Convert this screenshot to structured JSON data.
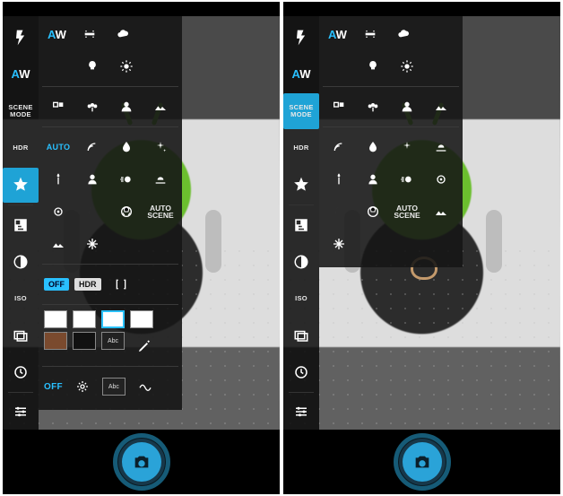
{
  "accent": "#29c0ff",
  "sidebar": {
    "items": [
      {
        "name": "flash-icon",
        "label": ""
      },
      {
        "name": "awb-icon",
        "label": "AW"
      },
      {
        "name": "scene-mode",
        "label": "SCENE\nMODE"
      },
      {
        "name": "hdr",
        "label": "HDR"
      },
      {
        "name": "favorite-star",
        "label": ""
      },
      {
        "name": "exposure-comp",
        "label": ""
      },
      {
        "name": "contrast",
        "label": ""
      },
      {
        "name": "iso",
        "label": "ISO"
      },
      {
        "name": "bracketing",
        "label": ""
      },
      {
        "name": "timer",
        "label": ""
      },
      {
        "name": "sliders",
        "label": ""
      }
    ]
  },
  "panel": {
    "wb": {
      "auto_label": "AW",
      "options": [
        "auto",
        "flash",
        "cloudy",
        "incandescent",
        "daylight"
      ]
    },
    "focus": {
      "options": [
        "burst",
        "macro",
        "portrait",
        "landscape"
      ]
    },
    "scene": {
      "auto_label": "AUTO",
      "options": [
        "curves",
        "droplet",
        "sparkle",
        "candle",
        "face",
        "motion",
        "night",
        "moon",
        "sports",
        "auto-scene",
        "sunset",
        "snow"
      ],
      "auto_scene_label": "AUTO\nSCENE"
    },
    "hdr_row": {
      "off_label": "OFF",
      "hdr_label": "HDR"
    },
    "filters": {
      "swatches": [
        "white",
        "white",
        "blue",
        "white",
        "sepia",
        "black",
        "label",
        "pencil"
      ],
      "label_text": "Abc"
    },
    "effects": {
      "off_label": "OFF",
      "items": [
        "gear",
        "abc",
        "wave"
      ]
    }
  },
  "shutter": {
    "icon": "camera"
  }
}
